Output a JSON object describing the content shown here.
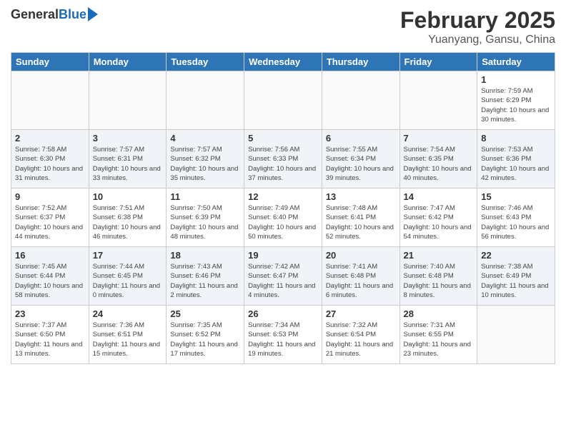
{
  "header": {
    "logo_general": "General",
    "logo_blue": "Blue",
    "title": "February 2025",
    "location": "Yuanyang, Gansu, China"
  },
  "days_of_week": [
    "Sunday",
    "Monday",
    "Tuesday",
    "Wednesday",
    "Thursday",
    "Friday",
    "Saturday"
  ],
  "weeks": [
    {
      "row_alt": false,
      "days": [
        {
          "num": "",
          "info": ""
        },
        {
          "num": "",
          "info": ""
        },
        {
          "num": "",
          "info": ""
        },
        {
          "num": "",
          "info": ""
        },
        {
          "num": "",
          "info": ""
        },
        {
          "num": "",
          "info": ""
        },
        {
          "num": "1",
          "info": "Sunrise: 7:59 AM\nSunset: 6:29 PM\nDaylight: 10 hours\nand 30 minutes."
        }
      ]
    },
    {
      "row_alt": true,
      "days": [
        {
          "num": "2",
          "info": "Sunrise: 7:58 AM\nSunset: 6:30 PM\nDaylight: 10 hours\nand 31 minutes."
        },
        {
          "num": "3",
          "info": "Sunrise: 7:57 AM\nSunset: 6:31 PM\nDaylight: 10 hours\nand 33 minutes."
        },
        {
          "num": "4",
          "info": "Sunrise: 7:57 AM\nSunset: 6:32 PM\nDaylight: 10 hours\nand 35 minutes."
        },
        {
          "num": "5",
          "info": "Sunrise: 7:56 AM\nSunset: 6:33 PM\nDaylight: 10 hours\nand 37 minutes."
        },
        {
          "num": "6",
          "info": "Sunrise: 7:55 AM\nSunset: 6:34 PM\nDaylight: 10 hours\nand 39 minutes."
        },
        {
          "num": "7",
          "info": "Sunrise: 7:54 AM\nSunset: 6:35 PM\nDaylight: 10 hours\nand 40 minutes."
        },
        {
          "num": "8",
          "info": "Sunrise: 7:53 AM\nSunset: 6:36 PM\nDaylight: 10 hours\nand 42 minutes."
        }
      ]
    },
    {
      "row_alt": false,
      "days": [
        {
          "num": "9",
          "info": "Sunrise: 7:52 AM\nSunset: 6:37 PM\nDaylight: 10 hours\nand 44 minutes."
        },
        {
          "num": "10",
          "info": "Sunrise: 7:51 AM\nSunset: 6:38 PM\nDaylight: 10 hours\nand 46 minutes."
        },
        {
          "num": "11",
          "info": "Sunrise: 7:50 AM\nSunset: 6:39 PM\nDaylight: 10 hours\nand 48 minutes."
        },
        {
          "num": "12",
          "info": "Sunrise: 7:49 AM\nSunset: 6:40 PM\nDaylight: 10 hours\nand 50 minutes."
        },
        {
          "num": "13",
          "info": "Sunrise: 7:48 AM\nSunset: 6:41 PM\nDaylight: 10 hours\nand 52 minutes."
        },
        {
          "num": "14",
          "info": "Sunrise: 7:47 AM\nSunset: 6:42 PM\nDaylight: 10 hours\nand 54 minutes."
        },
        {
          "num": "15",
          "info": "Sunrise: 7:46 AM\nSunset: 6:43 PM\nDaylight: 10 hours\nand 56 minutes."
        }
      ]
    },
    {
      "row_alt": true,
      "days": [
        {
          "num": "16",
          "info": "Sunrise: 7:45 AM\nSunset: 6:44 PM\nDaylight: 10 hours\nand 58 minutes."
        },
        {
          "num": "17",
          "info": "Sunrise: 7:44 AM\nSunset: 6:45 PM\nDaylight: 11 hours\nand 0 minutes."
        },
        {
          "num": "18",
          "info": "Sunrise: 7:43 AM\nSunset: 6:46 PM\nDaylight: 11 hours\nand 2 minutes."
        },
        {
          "num": "19",
          "info": "Sunrise: 7:42 AM\nSunset: 6:47 PM\nDaylight: 11 hours\nand 4 minutes."
        },
        {
          "num": "20",
          "info": "Sunrise: 7:41 AM\nSunset: 6:48 PM\nDaylight: 11 hours\nand 6 minutes."
        },
        {
          "num": "21",
          "info": "Sunrise: 7:40 AM\nSunset: 6:48 PM\nDaylight: 11 hours\nand 8 minutes."
        },
        {
          "num": "22",
          "info": "Sunrise: 7:38 AM\nSunset: 6:49 PM\nDaylight: 11 hours\nand 10 minutes."
        }
      ]
    },
    {
      "row_alt": false,
      "days": [
        {
          "num": "23",
          "info": "Sunrise: 7:37 AM\nSunset: 6:50 PM\nDaylight: 11 hours\nand 13 minutes."
        },
        {
          "num": "24",
          "info": "Sunrise: 7:36 AM\nSunset: 6:51 PM\nDaylight: 11 hours\nand 15 minutes."
        },
        {
          "num": "25",
          "info": "Sunrise: 7:35 AM\nSunset: 6:52 PM\nDaylight: 11 hours\nand 17 minutes."
        },
        {
          "num": "26",
          "info": "Sunrise: 7:34 AM\nSunset: 6:53 PM\nDaylight: 11 hours\nand 19 minutes."
        },
        {
          "num": "27",
          "info": "Sunrise: 7:32 AM\nSunset: 6:54 PM\nDaylight: 11 hours\nand 21 minutes."
        },
        {
          "num": "28",
          "info": "Sunrise: 7:31 AM\nSunset: 6:55 PM\nDaylight: 11 hours\nand 23 minutes."
        },
        {
          "num": "",
          "info": ""
        }
      ]
    }
  ]
}
